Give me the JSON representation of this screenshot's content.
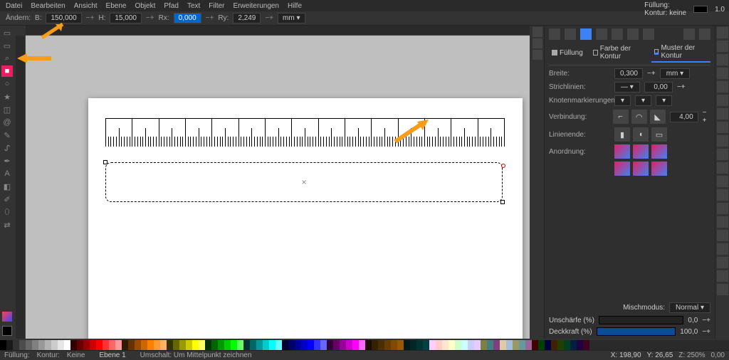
{
  "menu": [
    "Datei",
    "Bearbeiten",
    "Ansicht",
    "Ebene",
    "Objekt",
    "Pfad",
    "Text",
    "Filter",
    "Erweiterungen",
    "Hilfe"
  ],
  "opt": {
    "label": "Ändern:",
    "B_lbl": "B:",
    "B": "150,000",
    "H_lbl": "H:",
    "H": "15,000",
    "Rx_lbl": "Rx:",
    "Rx": "0,000",
    "Ry_lbl": "Ry:",
    "Ry": "2,249",
    "unit": "mm ▾"
  },
  "topright": {
    "fill_lbl": "Füllung:",
    "stroke_lbl": "Kontur:",
    "stroke_val": "keine",
    "op": "1.0"
  },
  "tools": [
    "▭",
    "▭",
    "⬚",
    "■",
    "○",
    "★",
    "✎",
    "A",
    "ᴛ",
    "⬈",
    "◐",
    "⎌",
    "✂",
    "⌂",
    "⍉",
    "+"
  ],
  "tools_active_idx": 3,
  "panel": {
    "tabs": {
      "fill": "Füllung",
      "stroke_paint": "Farbe der Kontur",
      "stroke_style": "Muster der Kontur"
    },
    "rows": {
      "width_lbl": "Breite:",
      "width": "0,300",
      "width_unit": "mm ▾",
      "dash_lbl": "Strichlinien:",
      "dash_val": "— ▾",
      "dash_off": "0,00",
      "markers_lbl": "Knotenmarkierungen:",
      "join_lbl": "Verbindung:",
      "join_miter": "4,00",
      "cap_lbl": "Linienende:",
      "order_lbl": "Anordnung:"
    },
    "blend_lbl": "Mischmodus:",
    "blend_val": "Normal ▾",
    "blur_lbl": "Unschärfe (%)",
    "blur_val": "0,0",
    "op_lbl": "Deckkraft (%)",
    "op_val": "100,0"
  },
  "status": {
    "fill": "Füllung:",
    "stroke": "Kontur:",
    "none": "Keine",
    "layer": "Ebene 1",
    "msg": "Umschalt: Um Mittelpunkt zeichnen",
    "x_lbl": "X:",
    "x": "198,90",
    "y_lbl": "Y:",
    "y": "26,65",
    "zoom": "Z: 250%",
    "rot": "0,00"
  },
  "palette_bg": [
    "#000000",
    "#1a1a1a",
    "#333333",
    "#4d4d4d",
    "#666666",
    "#808080",
    "#999999",
    "#b3b3b3",
    "#cccccc",
    "#e6e6e6",
    "#ffffff",
    "#330000",
    "#660000",
    "#990000",
    "#cc0000",
    "#ff0000",
    "#ff3333",
    "#ff6666",
    "#ff9999",
    "#331900",
    "#663300",
    "#994c00",
    "#cc6600",
    "#ff8000",
    "#ff9933",
    "#ffb266",
    "#333300",
    "#666600",
    "#999900",
    "#cccc00",
    "#ffff00",
    "#ffff66",
    "#003300",
    "#006600",
    "#009900",
    "#00cc00",
    "#00ff00",
    "#66ff66",
    "#003333",
    "#006666",
    "#009999",
    "#00cccc",
    "#00ffff",
    "#66ffff",
    "#000033",
    "#000066",
    "#000099",
    "#0000cc",
    "#0000ff",
    "#3333ff",
    "#6666ff",
    "#330033",
    "#660066",
    "#990099",
    "#cc00cc",
    "#ff00ff",
    "#ff66ff",
    "#1a0d00",
    "#332100",
    "#4d2e00",
    "#663c00",
    "#804a00",
    "#995700",
    "#001a1a",
    "#002626",
    "#003333",
    "#004040",
    "#ffccff",
    "#ffcccc",
    "#ffe6cc",
    "#ffffcc",
    "#ccffcc",
    "#ccffff",
    "#ccccff",
    "#e6ccff",
    "#808040",
    "#408080",
    "#804080",
    "#decba4",
    "#a4bedc",
    "#999966",
    "#669999",
    "#996699",
    "#400000",
    "#004000",
    "#000040",
    "#402000",
    "#204000",
    "#004020",
    "#002040",
    "#200040",
    "#400020"
  ]
}
